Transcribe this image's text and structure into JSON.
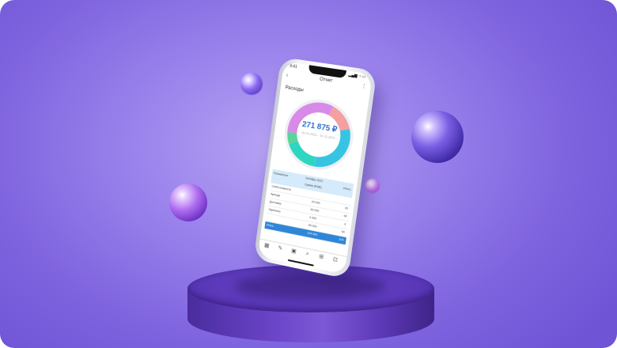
{
  "phone": {
    "status_time": "9:41",
    "header_title": "Отчет",
    "section_label": "Расходы",
    "total_amount": "271 875 ₽",
    "period": "01.01.2021 - 31.12.2021",
    "back_icon": "chevron-left-icon",
    "menu_icon": "more-vertical-icon",
    "donut": [
      {
        "label": "segment-1",
        "value": 0.14,
        "color": "#f4a0a0"
      },
      {
        "label": "segment-2",
        "value": 0.3,
        "color": "#37c4e2"
      },
      {
        "label": "segment-3",
        "value": 0.18,
        "color": "#2dd6bf"
      },
      {
        "label": "segment-4",
        "value": 0.06,
        "color": "#58d59b"
      },
      {
        "label": "segment-5",
        "value": 0.32,
        "color": "#d88ae8"
      }
    ],
    "table": {
      "col_indicator": "Показатели",
      "col_month": "Октябрь 2021",
      "col_sum": "Сумма (RUB)",
      "col_total": "Итого",
      "rows": [
        {
          "name": "Себестоимость",
          "value": "",
          "total": ""
        },
        {
          "name": "Аренда",
          "value": "20 000",
          "total": "20"
        },
        {
          "name": "Доставка",
          "value": "90 000",
          "total": "90"
        },
        {
          "name": "Зарплата",
          "value": "4 000",
          "total": "4"
        },
        {
          "name": "",
          "value": "90 000",
          "total": "90"
        },
        {
          "name": "Итого",
          "value": "104 000",
          "total": "104"
        }
      ]
    },
    "tabs": [
      "chart-icon",
      "edit-icon",
      "calendar-icon",
      "search-icon",
      "plus-icon",
      "dots-icon"
    ]
  }
}
